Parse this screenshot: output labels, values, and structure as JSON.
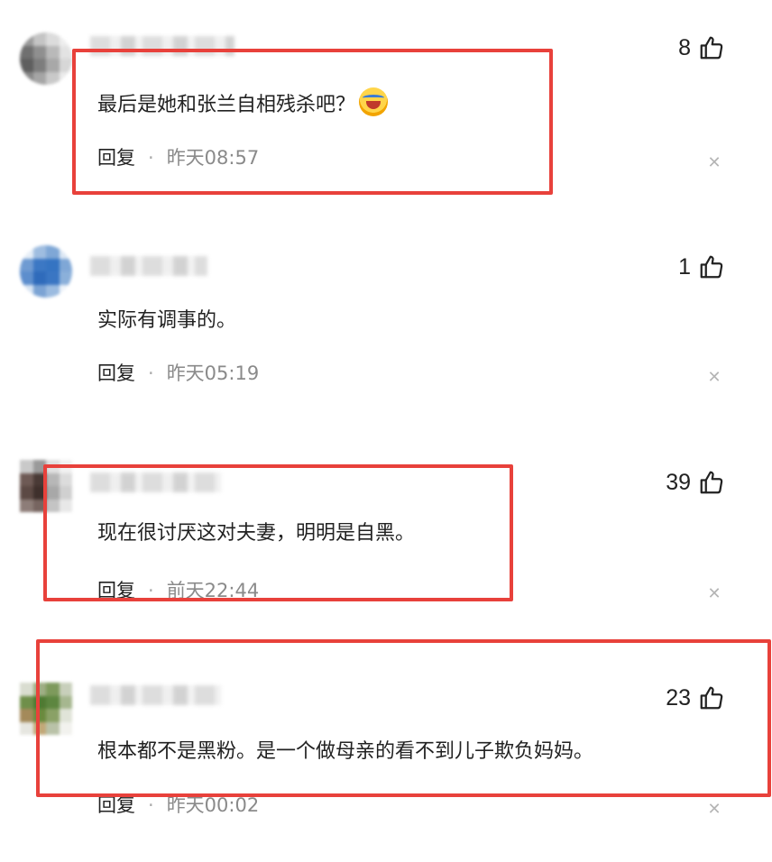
{
  "comments": [
    {
      "text": "最后是她和张兰自相残杀吧？",
      "emoji": "laughing-crying-emoji",
      "reply_label": "回复",
      "separator": "·",
      "time": "昨天08:57",
      "likes": "8"
    },
    {
      "text": "实际有调事的。",
      "reply_label": "回复",
      "separator": "·",
      "time": "昨天05:19",
      "likes": "1"
    },
    {
      "text": "现在很讨厌这对夫妻，明明是自黑。",
      "reply_label": "回复",
      "separator": "·",
      "time": "前天22:44",
      "likes": "39"
    },
    {
      "text": "根本都不是黑粉。是一个做母亲的看不到儿子欺负妈妈。",
      "reply_label": "回复",
      "separator": "·",
      "time": "昨天00:02",
      "likes": "23"
    }
  ],
  "icons": {
    "like": "thumbs-up-icon",
    "close": "close-icon"
  },
  "colors": {
    "highlight_border": "#e8413b",
    "timestamp": "#8a8a8a",
    "close_icon": "#b5b5b5"
  }
}
